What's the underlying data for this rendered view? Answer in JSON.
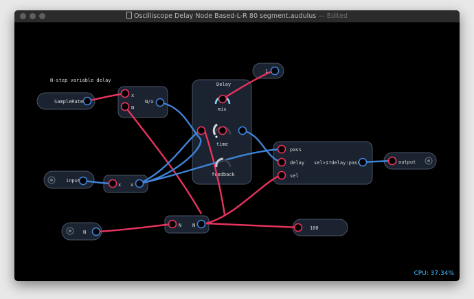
{
  "window": {
    "title": "Oscilliscope Delay Node Based-L-R 80 segment.audulus",
    "edited": "— Edited"
  },
  "canvas": {
    "comment": "N-step variable delay",
    "samplerate": {
      "label": "SampleRate"
    },
    "nx": {
      "in_x": "x",
      "in_n": "N",
      "out": "N/x"
    },
    "input": {
      "label": "input"
    },
    "mult_x": {
      "in": "x",
      "out": "x"
    },
    "n_in": {
      "label": "N"
    },
    "n_mid": {
      "in": "N",
      "out": "N"
    },
    "one": {
      "label": "1"
    },
    "hundred": {
      "label": "100"
    },
    "delay": {
      "title": "Delay",
      "mix": "mix",
      "time": "time",
      "feedback": "feedback"
    },
    "expr": {
      "pass": "pass",
      "delay": "delay",
      "sel": "sel",
      "expression": "sel>1?delay:pass"
    },
    "output": {
      "label": "output"
    }
  },
  "status": {
    "cpu": "CPU: 37.34%"
  },
  "colors": {
    "blue": "#3f84d8",
    "red": "#e8335e",
    "node": "#1b2330",
    "border": "#4a5666"
  }
}
